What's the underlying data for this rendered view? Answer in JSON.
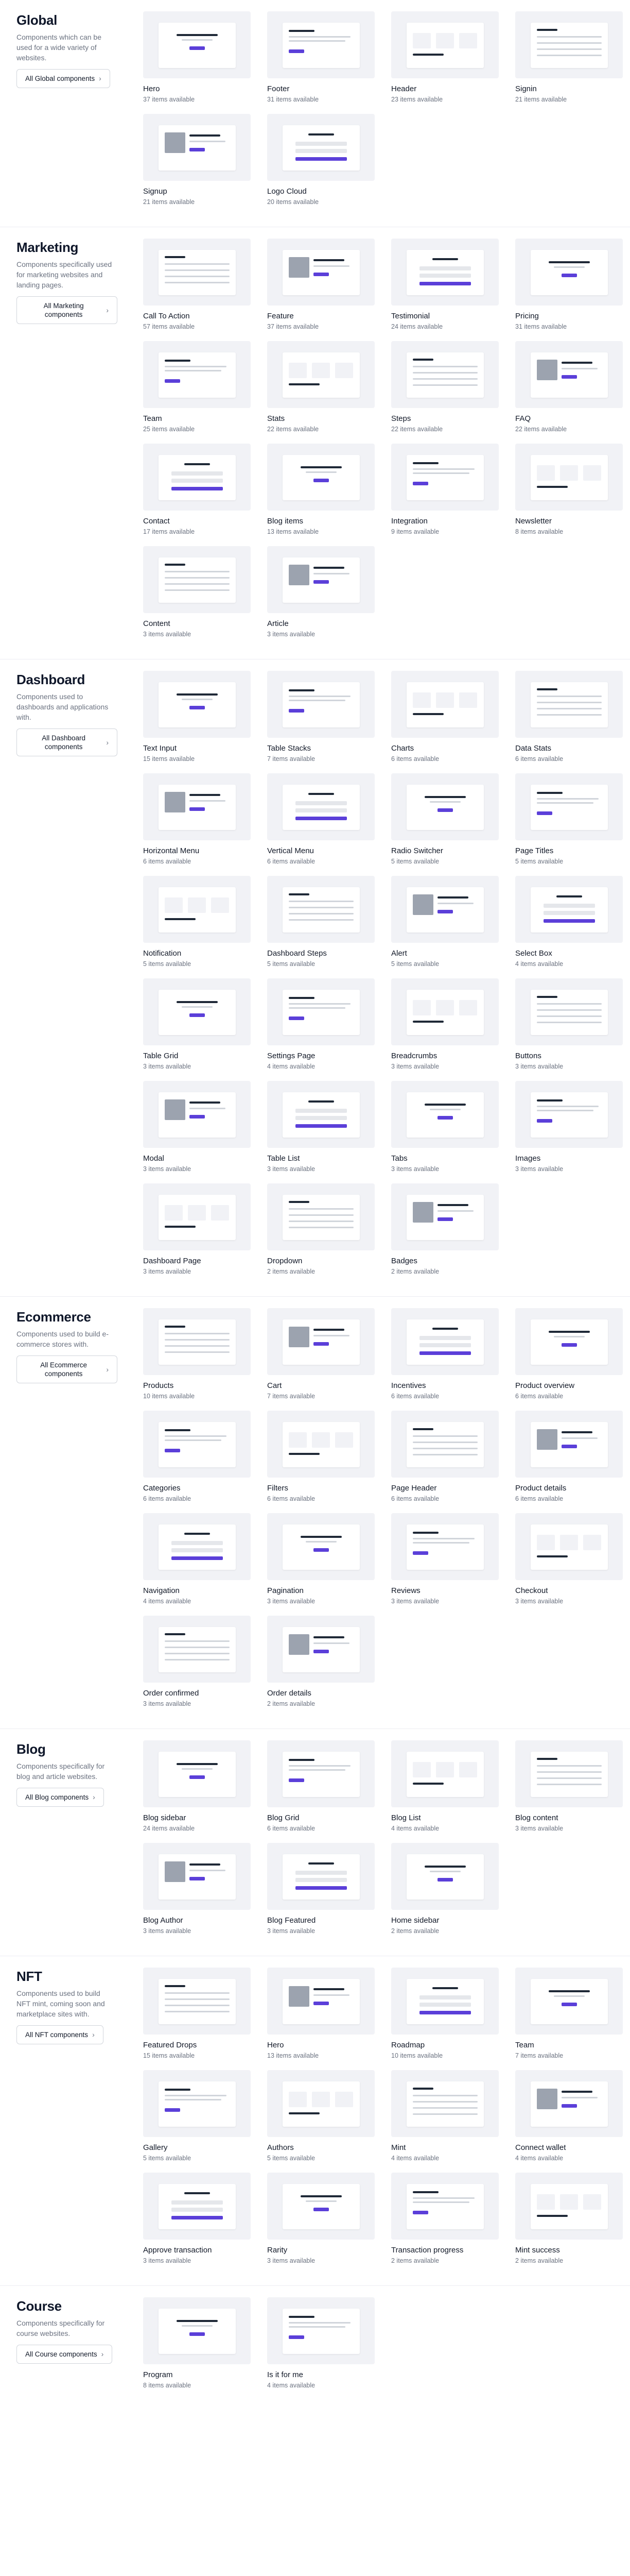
{
  "accent": "#5b3fd9",
  "sections": [
    {
      "title": "Global",
      "desc": "Components which can be used for a wide variety of websites.",
      "button": "All Global components",
      "items": [
        {
          "name": "Hero",
          "count": "37 items available"
        },
        {
          "name": "Footer",
          "count": "31 items available"
        },
        {
          "name": "Header",
          "count": "23 items available"
        },
        {
          "name": "Signin",
          "count": "21 items available"
        },
        {
          "name": "Signup",
          "count": "21 items available"
        },
        {
          "name": "Logo Cloud",
          "count": "20 items available"
        }
      ]
    },
    {
      "title": "Marketing",
      "desc": "Components specifically used for marketing websites and landing pages.",
      "button": "All Marketing components",
      "items": [
        {
          "name": "Call To Action",
          "count": "57 items available"
        },
        {
          "name": "Feature",
          "count": "37 items available"
        },
        {
          "name": "Testimonial",
          "count": "24 items available"
        },
        {
          "name": "Pricing",
          "count": "31 items available"
        },
        {
          "name": "Team",
          "count": "25 items available"
        },
        {
          "name": "Stats",
          "count": "22 items available"
        },
        {
          "name": "Steps",
          "count": "22 items available"
        },
        {
          "name": "FAQ",
          "count": "22 items available"
        },
        {
          "name": "Contact",
          "count": "17 items available"
        },
        {
          "name": "Blog items",
          "count": "13 items available"
        },
        {
          "name": "Integration",
          "count": "9 items available"
        },
        {
          "name": "Newsletter",
          "count": "8 items available"
        },
        {
          "name": "Content",
          "count": "3 items available"
        },
        {
          "name": "Article",
          "count": "3 items available"
        }
      ]
    },
    {
      "title": "Dashboard",
      "desc": "Components used to dashboards and applications with.",
      "button": "All Dashboard components",
      "items": [
        {
          "name": "Text Input",
          "count": "15 items available"
        },
        {
          "name": "Table Stacks",
          "count": "7 items available"
        },
        {
          "name": "Charts",
          "count": "6 items available"
        },
        {
          "name": "Data Stats",
          "count": "6 items available"
        },
        {
          "name": "Horizontal Menu",
          "count": "6 items available"
        },
        {
          "name": "Vertical Menu",
          "count": "6 items available"
        },
        {
          "name": "Radio Switcher",
          "count": "5 items available"
        },
        {
          "name": "Page Titles",
          "count": "5 items available"
        },
        {
          "name": "Notification",
          "count": "5 items available"
        },
        {
          "name": "Dashboard Steps",
          "count": "5 items available"
        },
        {
          "name": "Alert",
          "count": "5 items available"
        },
        {
          "name": "Select Box",
          "count": "4 items available"
        },
        {
          "name": "Table Grid",
          "count": "3 items available"
        },
        {
          "name": "Settings Page",
          "count": "4 items available"
        },
        {
          "name": "Breadcrumbs",
          "count": "3 items available"
        },
        {
          "name": "Buttons",
          "count": "3 items available"
        },
        {
          "name": "Modal",
          "count": "3 items available"
        },
        {
          "name": "Table List",
          "count": "3 items available"
        },
        {
          "name": "Tabs",
          "count": "3 items available"
        },
        {
          "name": "Images",
          "count": "3 items available"
        },
        {
          "name": "Dashboard Page",
          "count": "3 items available"
        },
        {
          "name": "Dropdown",
          "count": "2 items available"
        },
        {
          "name": "Badges",
          "count": "2 items available"
        }
      ]
    },
    {
      "title": "Ecommerce",
      "desc": "Components used to build e-commerce stores with.",
      "button": "All Ecommerce components",
      "items": [
        {
          "name": "Products",
          "count": "10 items available"
        },
        {
          "name": "Cart",
          "count": "7 items available"
        },
        {
          "name": "Incentives",
          "count": "6 items available"
        },
        {
          "name": "Product overview",
          "count": "6 items available"
        },
        {
          "name": "Categories",
          "count": "6 items available"
        },
        {
          "name": "Filters",
          "count": "6 items available"
        },
        {
          "name": "Page Header",
          "count": "6 items available"
        },
        {
          "name": "Product details",
          "count": "6 items available"
        },
        {
          "name": "Navigation",
          "count": "4 items available"
        },
        {
          "name": "Pagination",
          "count": "3 items available"
        },
        {
          "name": "Reviews",
          "count": "3 items available"
        },
        {
          "name": "Checkout",
          "count": "3 items available"
        },
        {
          "name": "Order confirmed",
          "count": "3 items available"
        },
        {
          "name": "Order details",
          "count": "2 items available"
        }
      ]
    },
    {
      "title": "Blog",
      "desc": "Components specifically for blog and article websites.",
      "button": "All Blog components",
      "items": [
        {
          "name": "Blog sidebar",
          "count": "24 items available"
        },
        {
          "name": "Blog Grid",
          "count": "6 items available"
        },
        {
          "name": "Blog List",
          "count": "4 items available"
        },
        {
          "name": "Blog content",
          "count": "3 items available"
        },
        {
          "name": "Blog Author",
          "count": "3 items available"
        },
        {
          "name": "Blog Featured",
          "count": "3 items available"
        },
        {
          "name": "Home sidebar",
          "count": "2 items available"
        }
      ]
    },
    {
      "title": "NFT",
      "desc": "Components used to build NFT mint, coming soon and marketplace sites with.",
      "button": "All NFT components",
      "items": [
        {
          "name": "Featured Drops",
          "count": "15 items available"
        },
        {
          "name": "Hero",
          "count": "13 items available"
        },
        {
          "name": "Roadmap",
          "count": "10 items available"
        },
        {
          "name": "Team",
          "count": "7 items available"
        },
        {
          "name": "Gallery",
          "count": "5 items available"
        },
        {
          "name": "Authors",
          "count": "5 items available"
        },
        {
          "name": "Mint",
          "count": "4 items available"
        },
        {
          "name": "Connect wallet",
          "count": "4 items available"
        },
        {
          "name": "Approve transaction",
          "count": "3 items available"
        },
        {
          "name": "Rarity",
          "count": "3 items available"
        },
        {
          "name": "Transaction progress",
          "count": "2 items available"
        },
        {
          "name": "Mint success",
          "count": "2 items available"
        }
      ]
    },
    {
      "title": "Course",
      "desc": "Components specifically for course websites.",
      "button": "All Course components",
      "items": [
        {
          "name": "Program",
          "count": "8 items available"
        },
        {
          "name": "Is it for me",
          "count": "4 items available"
        }
      ]
    }
  ]
}
